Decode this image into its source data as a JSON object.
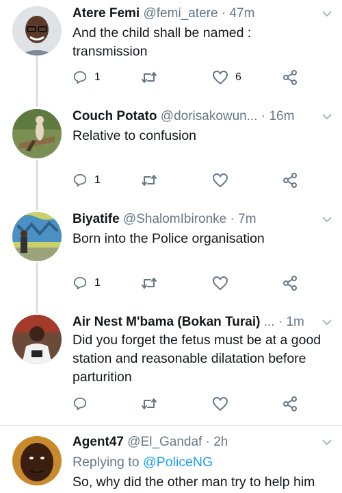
{
  "tweets": [
    {
      "name": "Atere Femi",
      "handle": "@femi_atere",
      "time": "· 47m",
      "text": "And the child shall be named :\ntransmission",
      "replies": "1",
      "likes": "6"
    },
    {
      "name": "Couch Potato",
      "handle": "@dorisakowun...",
      "time": "· 16m",
      "text": "Relative to confusion",
      "replies": "1"
    },
    {
      "name": "Biyatife",
      "handle": "@ShalomIbironke",
      "time": "· 7m",
      "text": "Born into the Police organisation",
      "replies": "1"
    },
    {
      "name": "Air Nest M'bama (Bokan Turai)",
      "handle": "...",
      "time": "· 1m",
      "text": "Did you forget the fetus must be at a good station and reasonable dilatation before parturition"
    },
    {
      "name": "Agent47",
      "handle": "@El_Gandaf",
      "time": "· 2h",
      "reply_prefix": "Replying to ",
      "reply_target": "@PoliceNG",
      "text": "So, why did the other man try to help him"
    }
  ],
  "icons": {
    "reply": "reply-icon",
    "retweet": "retweet-icon",
    "like": "heart-icon",
    "share": "share-icon",
    "menu": "chevron-down-icon"
  },
  "colors": {
    "text": "#14171a",
    "secondary": "#657786",
    "link": "#1da1f2",
    "thread_line": "#ccd6dd",
    "divider": "#e1e8ed"
  }
}
